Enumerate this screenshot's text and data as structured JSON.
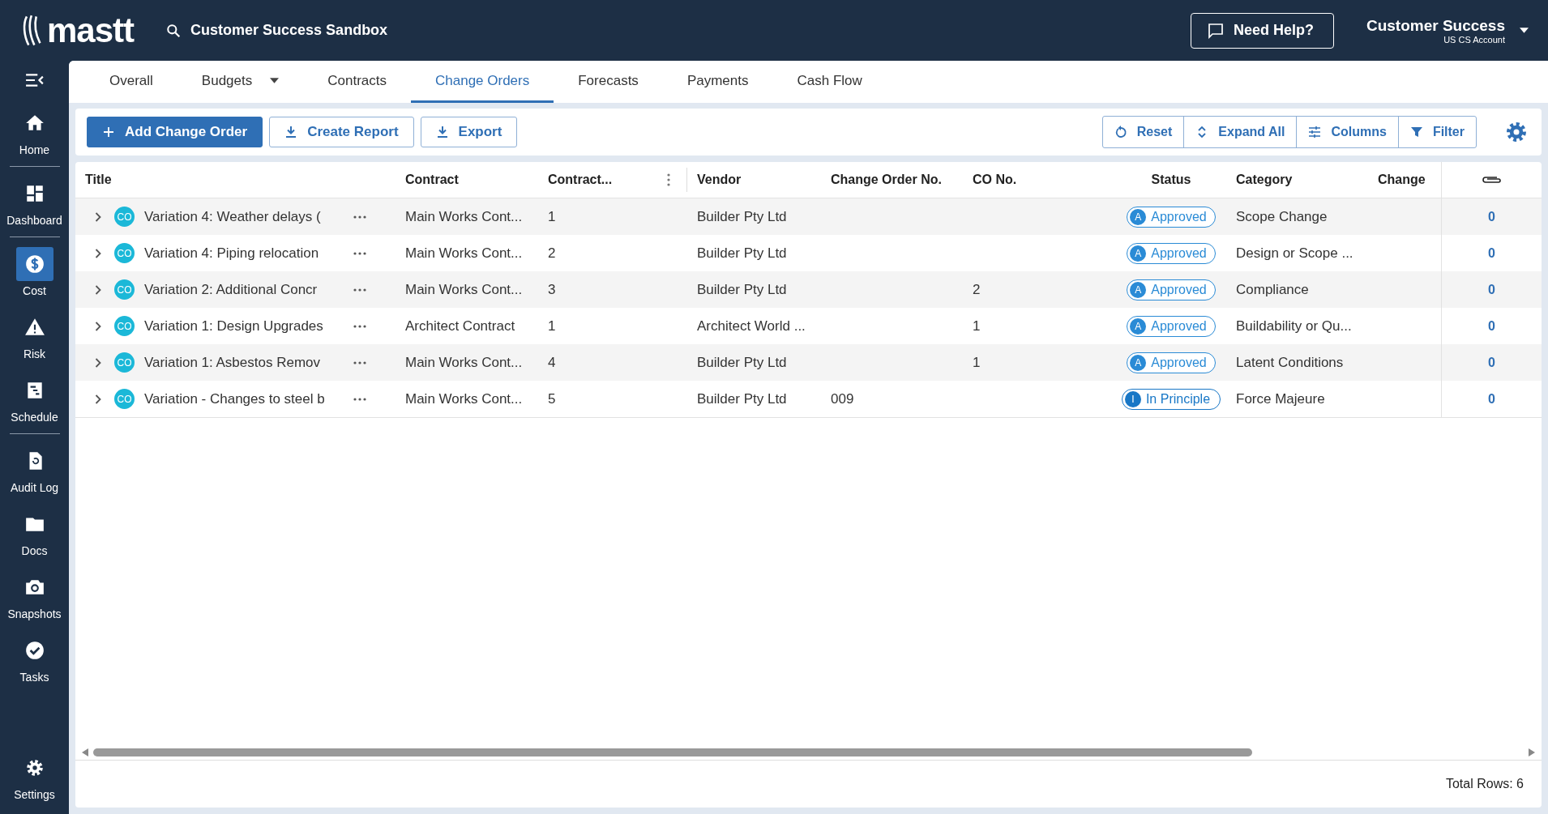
{
  "header": {
    "logo": "mastt",
    "project": "Customer Success Sandbox",
    "help_button": "Need Help?",
    "account": {
      "name": "Customer Success",
      "subtitle": "US CS Account"
    }
  },
  "sidebar": {
    "items": [
      {
        "label": "Home",
        "kind": "home",
        "selected": false
      },
      {
        "label": "Dashboard",
        "kind": "dashboard",
        "selected": false
      },
      {
        "label": "Cost",
        "kind": "cost",
        "selected": true
      },
      {
        "label": "Risk",
        "kind": "risk",
        "selected": false
      },
      {
        "label": "Schedule",
        "kind": "schedule",
        "selected": false
      },
      {
        "label": "Audit Log",
        "kind": "audit",
        "selected": false
      },
      {
        "label": "Docs",
        "kind": "docs",
        "selected": false
      },
      {
        "label": "Snapshots",
        "kind": "snapshots",
        "selected": false
      },
      {
        "label": "Tasks",
        "kind": "tasks",
        "selected": false
      }
    ],
    "bottom_item": {
      "label": "Settings",
      "kind": "settings"
    }
  },
  "tabs": [
    {
      "label": "Overall",
      "selected": false,
      "has_menu": false
    },
    {
      "label": "Budgets",
      "selected": false,
      "has_menu": true
    },
    {
      "label": "Contracts",
      "selected": false,
      "has_menu": false
    },
    {
      "label": "Change Orders",
      "selected": true,
      "has_menu": false
    },
    {
      "label": "Forecasts",
      "selected": false,
      "has_menu": false
    },
    {
      "label": "Payments",
      "selected": false,
      "has_menu": false
    },
    {
      "label": "Cash Flow",
      "selected": false,
      "has_menu": false
    }
  ],
  "toolbar": {
    "actions": [
      {
        "label": "Add Change Order",
        "kind": "add"
      },
      {
        "label": "Create Report",
        "kind": "download"
      },
      {
        "label": "Export",
        "kind": "download"
      }
    ],
    "tools": [
      {
        "label": "Reset",
        "kind": "reset"
      },
      {
        "label": "Expand All",
        "kind": "expand"
      },
      {
        "label": "Columns",
        "kind": "columns"
      },
      {
        "label": "Filter",
        "kind": "filter"
      }
    ]
  },
  "table": {
    "columns": [
      "Title",
      "Contract",
      "Contract...",
      "Vendor",
      "Change Order No.",
      "CO No.",
      "Status",
      "Category",
      "Change"
    ],
    "rows": [
      {
        "badge": "CO",
        "title": "Variation 4: Weather delays (",
        "contract": "Main Works Cont...",
        "contract_no": "1",
        "vendor": "Builder Pty Ltd",
        "status": {
          "kind": "approved",
          "letter": "A",
          "label": "Approved"
        },
        "category": "Scope Change",
        "attachments": "0"
      },
      {
        "badge": "CO",
        "title": "Variation 4: Piping relocation",
        "contract": "Main Works Cont...",
        "contract_no": "2",
        "vendor": "Builder Pty Ltd",
        "status": {
          "kind": "approved",
          "letter": "A",
          "label": "Approved"
        },
        "category": "Design or Scope ...",
        "attachments": "0"
      },
      {
        "badge": "CO",
        "title": "Variation 2: Additional Concr",
        "contract": "Main Works Cont...",
        "contract_no": "3",
        "vendor": "Builder Pty Ltd",
        "co_no": "2",
        "status": {
          "kind": "approved",
          "letter": "A",
          "label": "Approved"
        },
        "category": "Compliance",
        "attachments": "0"
      },
      {
        "badge": "CO",
        "title": "Variation 1: Design Upgrades",
        "contract": "Architect Contract",
        "contract_no": "1",
        "vendor": "Architect World ...",
        "co_no": "1",
        "status": {
          "kind": "approved",
          "letter": "A",
          "label": "Approved"
        },
        "category": "Buildability or Qu...",
        "attachments": "0"
      },
      {
        "badge": "CO",
        "title": "Variation 1: Asbestos Remov",
        "contract": "Main Works Cont...",
        "contract_no": "4",
        "vendor": "Builder Pty Ltd",
        "co_no": "1",
        "status": {
          "kind": "approved",
          "letter": "A",
          "label": "Approved"
        },
        "category": "Latent Conditions",
        "attachments": "0"
      },
      {
        "badge": "CO",
        "title": "Variation - Changes to steel b",
        "contract": "Main Works Cont...",
        "contract_no": "5",
        "vendor": "Builder Pty Ltd",
        "change_order_no": "009",
        "status": {
          "kind": "in_principle",
          "letter": "I",
          "label": "In Principle"
        },
        "category": "Force Majeure",
        "attachments": "0"
      }
    ]
  },
  "footer": {
    "total_rows": "Total Rows: 6"
  }
}
